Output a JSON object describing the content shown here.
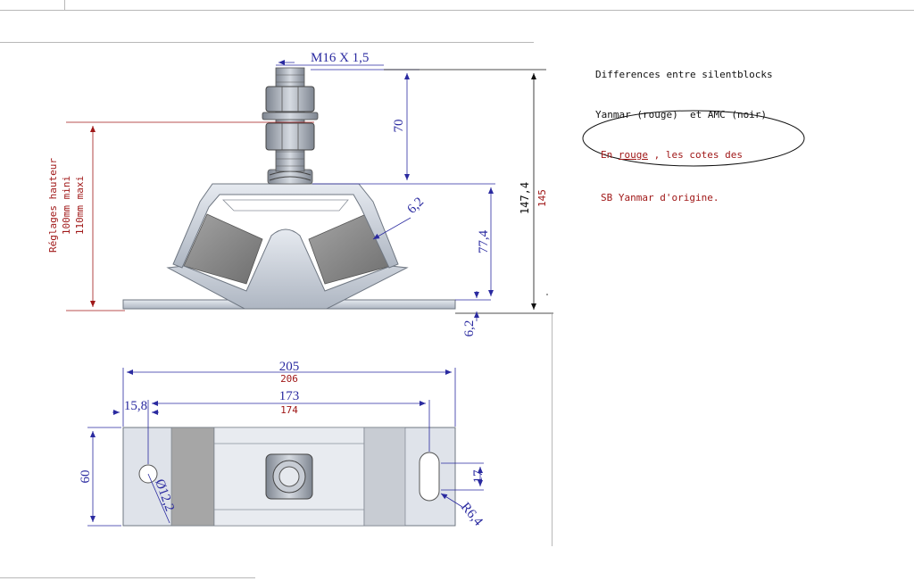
{
  "colors": {
    "dimension_blue": "#2a2aa0",
    "yanmar_red": "#a01818",
    "note_black": "#111111",
    "metal": "#c4cad3",
    "rubber": "#8a8a8a"
  },
  "notes": {
    "title_line1": "Differences entre silentblocks",
    "title_line2": "Yanmar (rouge)  et AMC (noir)",
    "legend_prefix": "En ",
    "legend_word": "rouge",
    "legend_rest": " , les cotes des",
    "legend_line2": "SB Yanmar d'origine."
  },
  "side_view": {
    "thread": "M16 X 1,5",
    "stud_height": "70",
    "body_height": "77,4",
    "total_amc": "147,4",
    "total_yanmar": "145",
    "plate_thickness": "6,2",
    "wall_thickness": "6,2",
    "adjust_line1": "Réglages hauteur",
    "adjust_line2": "100mm mini",
    "adjust_line3": "110mm maxi"
  },
  "top_view": {
    "length_amc": "205",
    "length_yanmar": "206",
    "hole_spacing_amc": "173",
    "hole_spacing_yanmar": "174",
    "edge_offset": "15,8",
    "width": "60",
    "hole_diameter": "Ø12,2",
    "slot_width": "17",
    "slot_radius": "R6,4"
  }
}
